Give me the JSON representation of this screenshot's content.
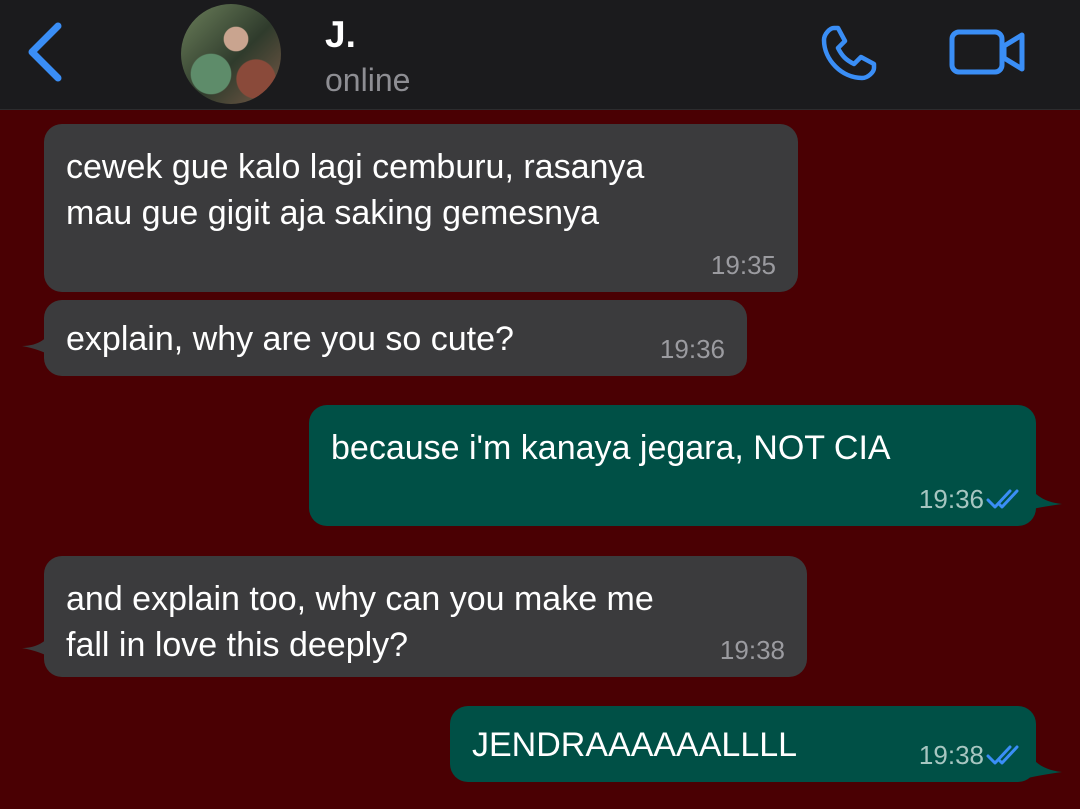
{
  "header": {
    "contact_name": "J.",
    "status": "online",
    "icons": [
      "back-chevron-icon",
      "avatar",
      "phone-icon",
      "video-camera-icon"
    ],
    "accent": "#3a8ef6"
  },
  "messages": [
    {
      "direction": "incoming",
      "text": "cewek gue kalo lagi cemburu, rasanya\nmau gue gigit aja saking gemesnya",
      "time": "19:35"
    },
    {
      "direction": "incoming",
      "text": "explain, why are you so cute?",
      "time": "19:36"
    },
    {
      "direction": "outgoing",
      "text": "because i'm kanaya jegara, NOT CIA",
      "time": "19:36",
      "read": true
    },
    {
      "direction": "incoming",
      "text": "and explain too, why can you make me\nfall in love this deeply?",
      "time": "19:38"
    },
    {
      "direction": "outgoing",
      "text": "JENDRAAAAAALLLL",
      "time": "19:38",
      "read": true
    }
  ],
  "colors": {
    "background": "#4a0003",
    "incoming_bubble": "#3b3b3d",
    "outgoing_bubble": "#005046",
    "read_ticks": "#3a8ef6"
  }
}
